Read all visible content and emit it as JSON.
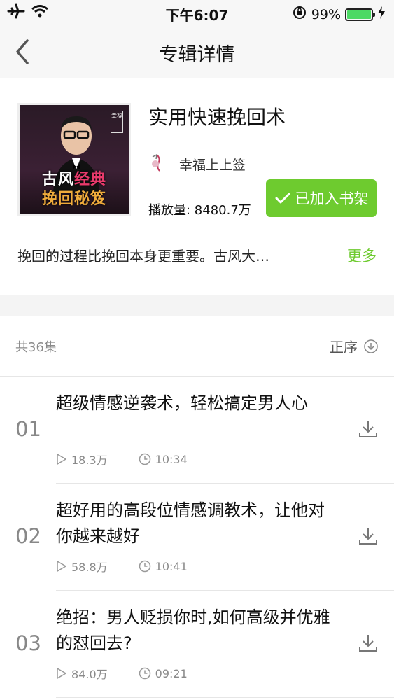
{
  "status_bar": {
    "time": "下午6:07",
    "battery_text": "99%",
    "battery_level": 0.99
  },
  "nav": {
    "title": "专辑详情"
  },
  "album": {
    "cover": {
      "badge": "幸福",
      "line1_a": "古风",
      "line1_b": "经典",
      "line2": "挽回秘笈"
    },
    "title": "实用快速挽回术",
    "author": "幸福上上签",
    "play_count": "播放量: 8480.7万",
    "shelf_button": "已加入书架",
    "description": "挽回的过程比挽回本身更重要。古风大…",
    "more_label": "更多"
  },
  "list": {
    "count": "共36集",
    "sort_label": "正序"
  },
  "episodes": [
    {
      "num": "01",
      "title": "超级情感逆袭术，轻松搞定男人心",
      "plays": "18.3万",
      "duration": "10:34"
    },
    {
      "num": "02",
      "title": "超好用的高段位情感调教术，让他对你越来越好",
      "plays": "58.8万",
      "duration": "10:41"
    },
    {
      "num": "03",
      "title": "绝招：男人贬损你时,如何高级并优雅的怼回去?",
      "plays": "84.0万",
      "duration": "09:21"
    }
  ],
  "colors": {
    "accent_green": "#6ecb2f",
    "battery_green": "#4cd964"
  },
  "icons": {
    "airplane": "airplane-icon",
    "wifi": "wifi-icon",
    "orientation_lock": "orientation-lock-icon",
    "battery": "battery-icon",
    "charging": "charging-icon",
    "back": "back-chevron-icon",
    "author": "author-avatar-icon",
    "check": "check-icon",
    "sort": "sort-down-icon",
    "play": "play-icon",
    "clock": "clock-icon",
    "download": "download-icon"
  }
}
